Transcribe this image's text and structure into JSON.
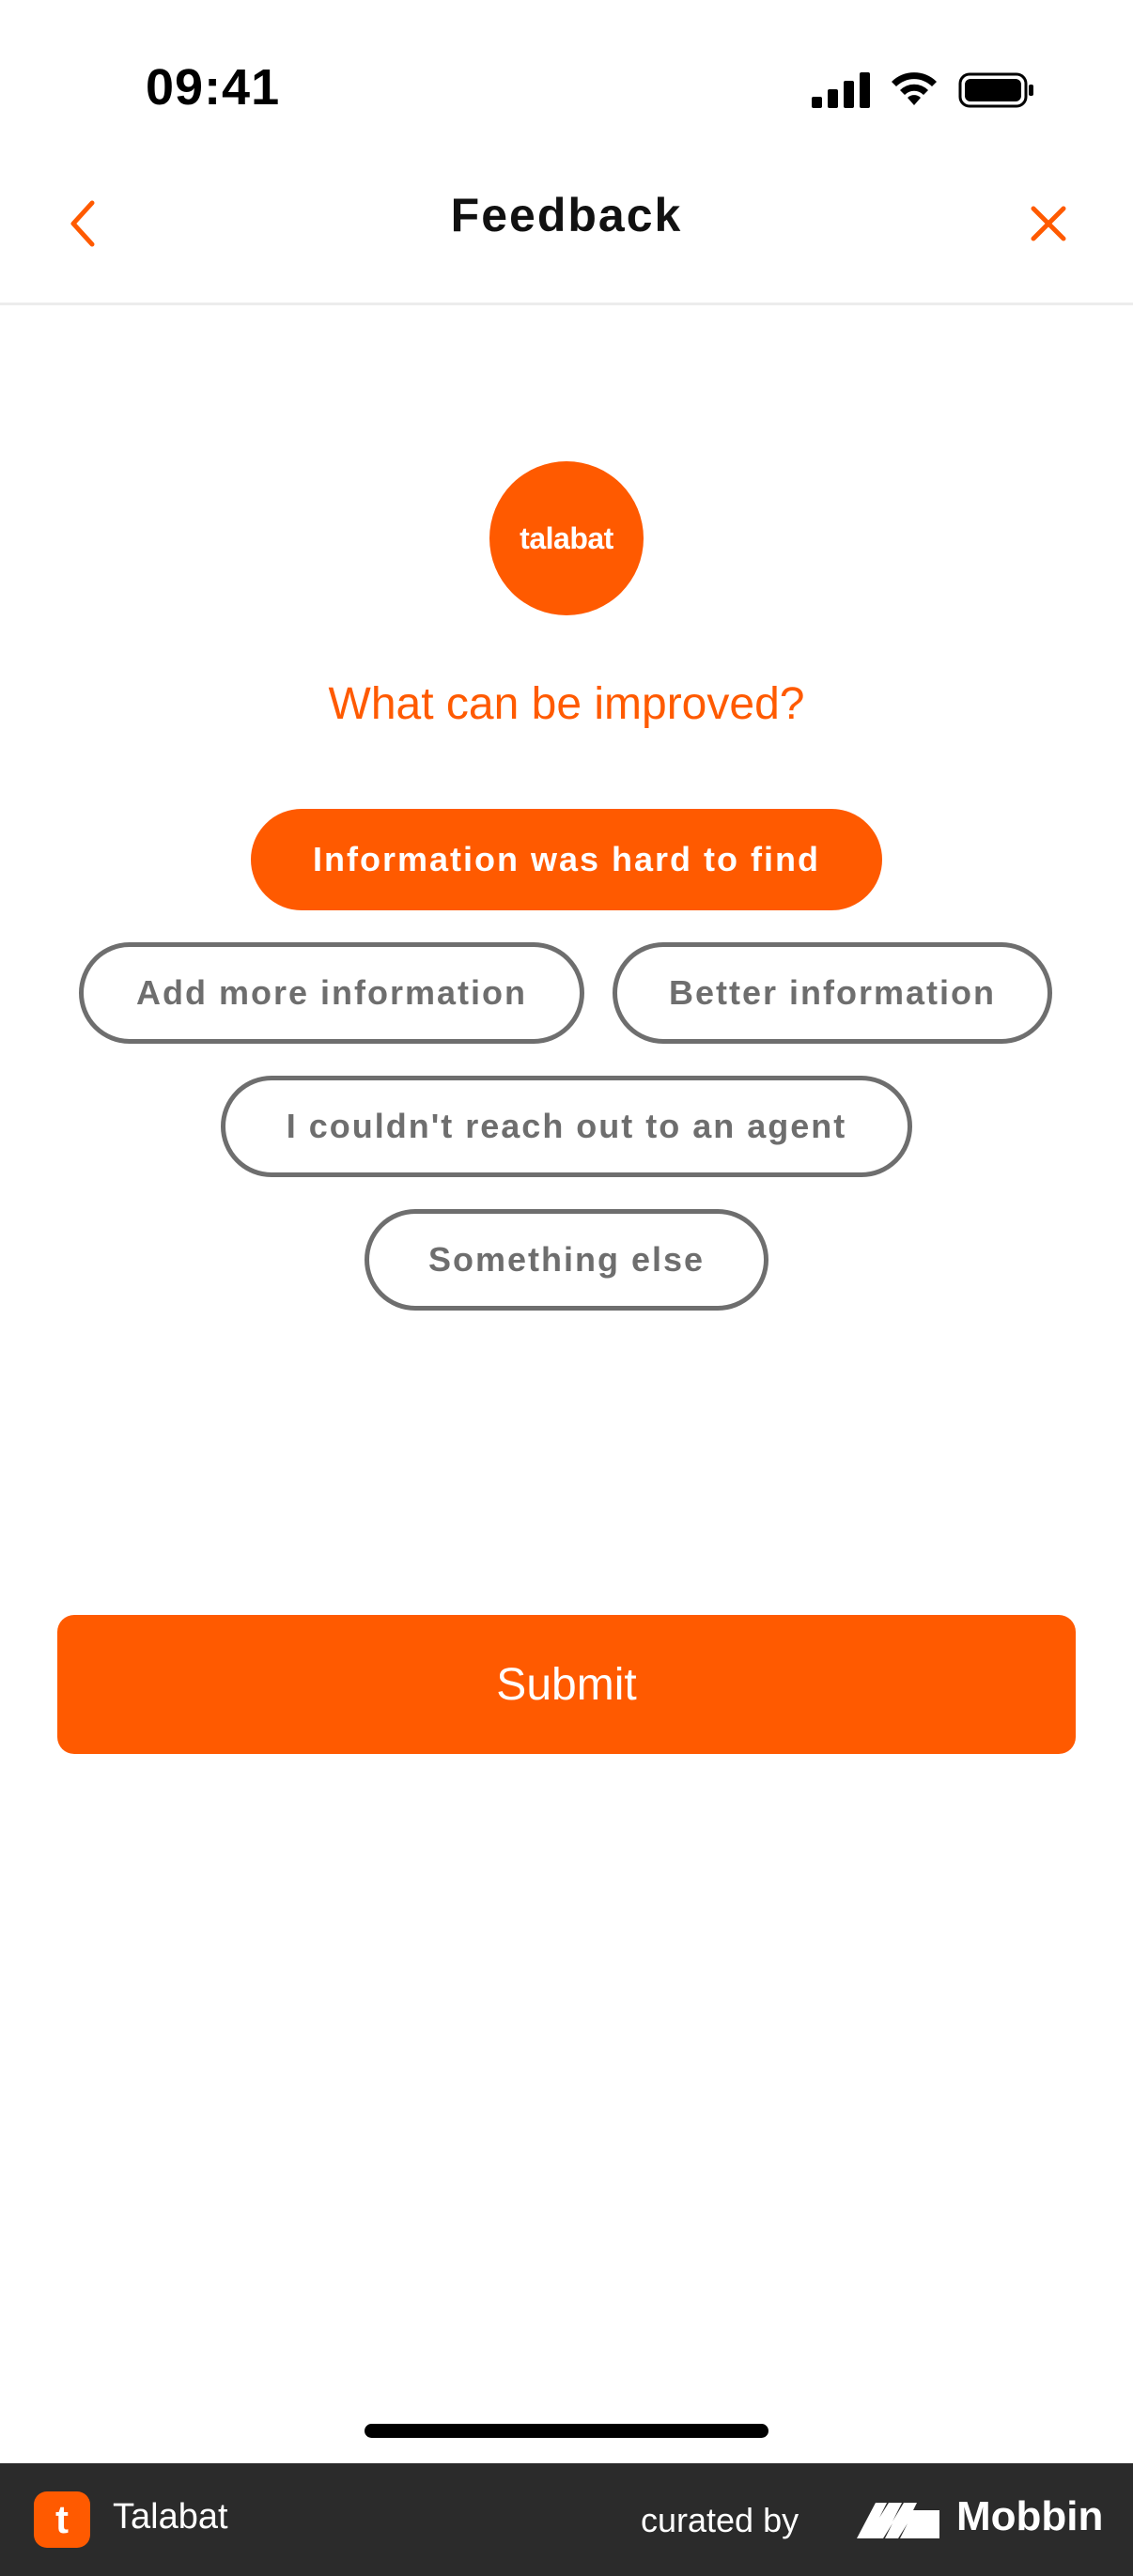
{
  "status_bar": {
    "time": "09:41",
    "icons": [
      "cellular-signal-icon",
      "wifi-icon",
      "battery-icon"
    ]
  },
  "nav": {
    "title": "Feedback",
    "back_icon": "chevron-left-icon",
    "close_icon": "close-icon"
  },
  "logo": {
    "text": "talabat"
  },
  "question": "What can be improved?",
  "chips": [
    {
      "label": "Information was hard to find",
      "selected": true
    },
    {
      "label": "Add more information",
      "selected": false
    },
    {
      "label": "Better information",
      "selected": false
    },
    {
      "label": "I couldn't reach out to an agent",
      "selected": false
    },
    {
      "label": "Something else",
      "selected": false
    }
  ],
  "submit_label": "Submit",
  "footer": {
    "app_icon_letter": "t",
    "app_name": "Talabat",
    "curated_by": "curated by",
    "brand_name": "Mobbin"
  },
  "colors": {
    "accent": "#ff5a00",
    "chip_border": "#6e6e6e",
    "footer_bg": "#2b2b2b"
  }
}
